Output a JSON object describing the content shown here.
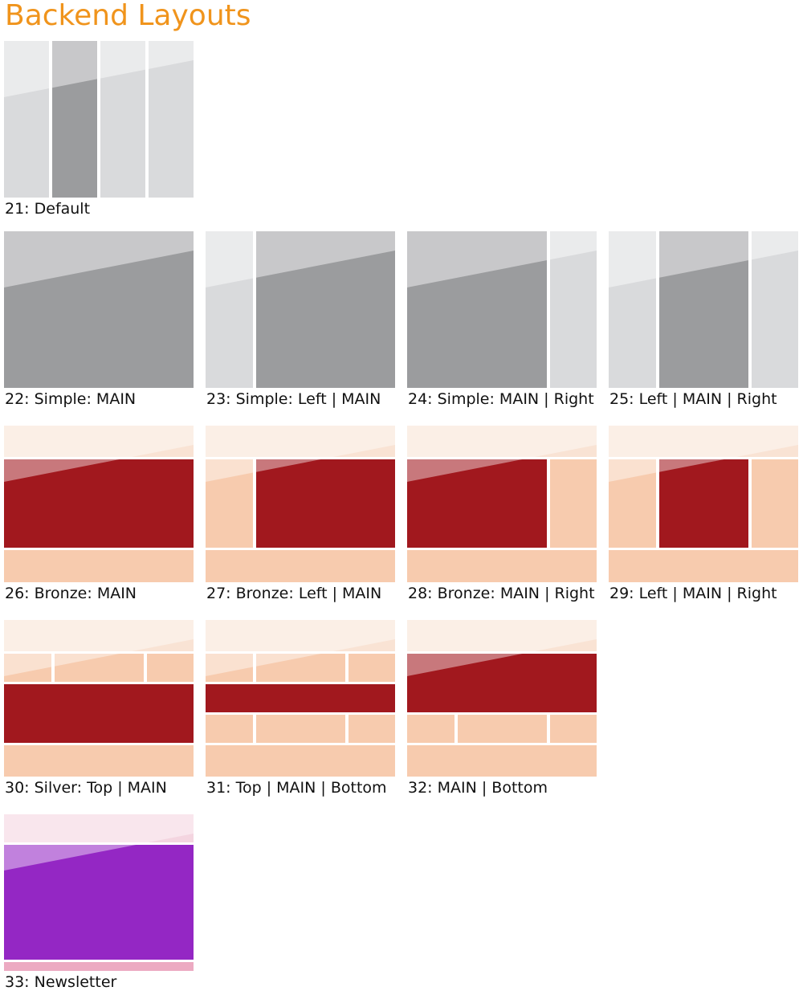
{
  "page_title": "Backend Layouts",
  "colors": {
    "title": "#f0941c",
    "gray_light": "#d9dadc",
    "gray_dark": "#9b9c9e",
    "bronze_light": "#f7cbae",
    "bronze_top": "#f9e3d4",
    "bronze_main": "#a1181e",
    "newsletter_top": "#f4d5e0",
    "newsletter_main": "#9427c4",
    "newsletter_bottom": "#ecaac2"
  },
  "layouts": [
    {
      "id": 21,
      "label": "21: Default",
      "theme": "gray",
      "structure": "4col-second-main"
    },
    {
      "id": 22,
      "label": "22: Simple: MAIN",
      "theme": "gray",
      "structure": "main"
    },
    {
      "id": 23,
      "label": "23: Simple: Left | MAIN",
      "theme": "gray",
      "structure": "left-main"
    },
    {
      "id": 24,
      "label": "24: Simple: MAIN | Right",
      "theme": "gray",
      "structure": "main-right"
    },
    {
      "id": 25,
      "label": "25: Left | MAIN | Right",
      "theme": "gray",
      "structure": "left-main-right"
    },
    {
      "id": 26,
      "label": "26: Bronze: MAIN",
      "theme": "bronze",
      "structure": "top-main-bottom"
    },
    {
      "id": 27,
      "label": "27: Bronze: Left | MAIN",
      "theme": "bronze",
      "structure": "top-left-main-bottom"
    },
    {
      "id": 28,
      "label": "28: Bronze: MAIN | Right",
      "theme": "bronze",
      "structure": "top-main-right-bottom"
    },
    {
      "id": 29,
      "label": "29: Left | MAIN | Right",
      "theme": "bronze",
      "structure": "top-left-main-right-bottom"
    },
    {
      "id": 30,
      "label": "30: Silver: Top | MAIN",
      "theme": "bronze",
      "structure": "top-3col-main-bottom"
    },
    {
      "id": 31,
      "label": "31: Top | MAIN | Bottom",
      "theme": "bronze",
      "structure": "top-3col-main-3col-bottom"
    },
    {
      "id": 32,
      "label": "32: MAIN | Bottom",
      "theme": "bronze",
      "structure": "top-main-3col-bottom"
    },
    {
      "id": 33,
      "label": "33: Newsletter",
      "theme": "newsletter",
      "structure": "newsletter"
    }
  ]
}
